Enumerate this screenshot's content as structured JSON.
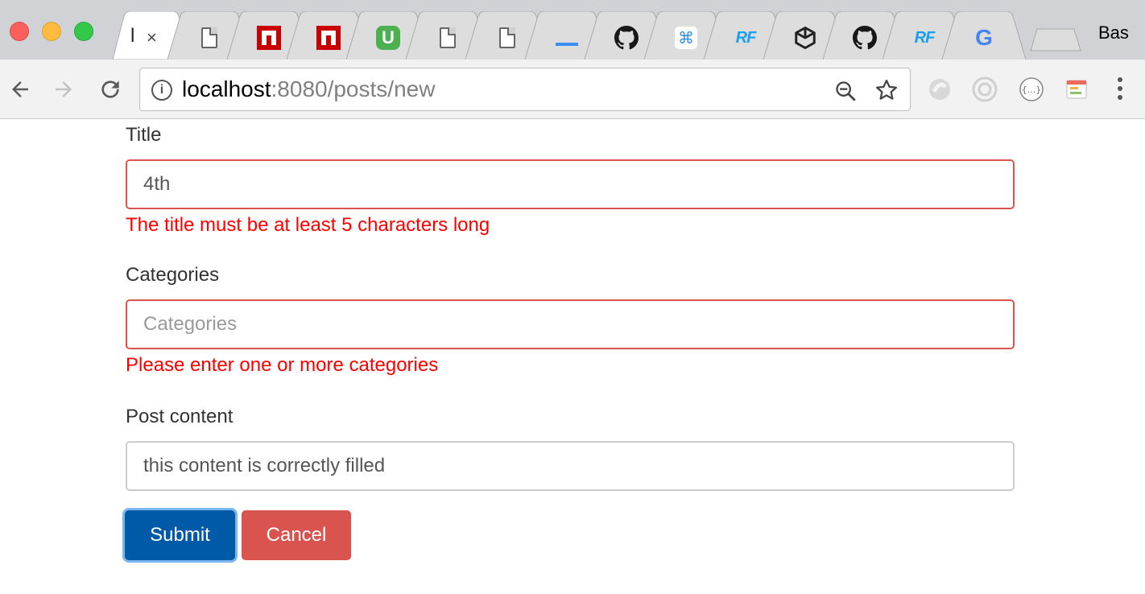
{
  "browser": {
    "active_tab": {
      "title": "l",
      "close": "×"
    },
    "tabs": [
      {
        "icon": "document-icon"
      },
      {
        "icon": "npm-icon"
      },
      {
        "icon": "npm-icon"
      },
      {
        "icon": "udemy-icon",
        "glyph": "U"
      },
      {
        "icon": "document-icon"
      },
      {
        "icon": "document-icon"
      },
      {
        "icon": "underscore-icon"
      },
      {
        "icon": "github-icon"
      },
      {
        "icon": "command-icon",
        "glyph": "⌘"
      },
      {
        "icon": "rf-icon",
        "glyph": "RF"
      },
      {
        "icon": "codepen-icon"
      },
      {
        "icon": "github-icon"
      },
      {
        "icon": "rf-icon",
        "glyph": "RF"
      },
      {
        "icon": "google-icon",
        "glyph": "G"
      }
    ],
    "profile_name": "Bas",
    "url_host": "localhost",
    "url_rest": ":8080/posts/new",
    "info_glyph": "i"
  },
  "form": {
    "title": {
      "label": "Title",
      "value": "4th",
      "placeholder": "",
      "error": "The title must be at least 5 characters long"
    },
    "categories": {
      "label": "Categories",
      "value": "",
      "placeholder": "Categories",
      "error": "Please enter one or more categories"
    },
    "content": {
      "label": "Post content",
      "value": "this content is correctly filled",
      "placeholder": ""
    },
    "submit_label": "Submit",
    "cancel_label": "Cancel"
  },
  "colors": {
    "error": "#ff0000",
    "error_border": "#d9534f",
    "primary": "#015aa8",
    "danger": "#d9534f"
  }
}
